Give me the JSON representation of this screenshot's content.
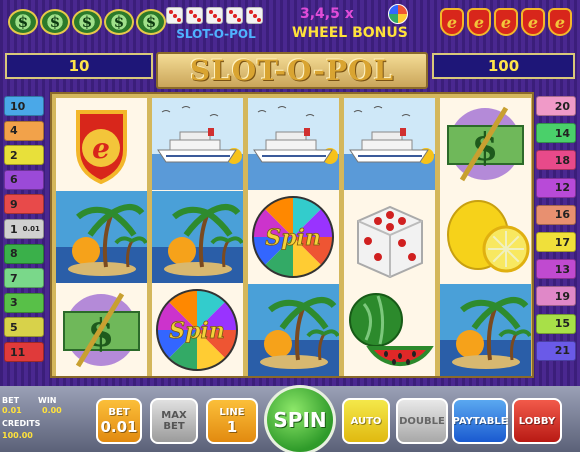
{
  "header": {
    "dollar_symbol": "$",
    "slot_o_pol_small": "SLOT-O-POL",
    "wheel_multipliers": "3,4,5 x",
    "wheel_bonus": "WHEEL BONUS",
    "e_symbol": "e"
  },
  "left_display": "10",
  "right_display": "100",
  "title": "SLOT-O-POL",
  "reels": [
    [
      "e-shield",
      "palm-island",
      "dollar-bill"
    ],
    [
      "cruise-ship",
      "palm-island",
      "spin-wheel"
    ],
    [
      "cruise-ship",
      "spin-wheel",
      "palm-island"
    ],
    [
      "cruise-ship",
      "dice",
      "watermelon"
    ],
    [
      "dollar-bill",
      "lemon",
      "palm-island"
    ]
  ],
  "symbol_text": {
    "spin": "Spin",
    "e": "e",
    "dollar": "$"
  },
  "lines_left": [
    {
      "label": "10",
      "color": "#4aa8e8"
    },
    {
      "label": "4",
      "color": "#f2a24a"
    },
    {
      "label": "2",
      "color": "#e8e03a"
    },
    {
      "label": "6",
      "color": "#9b4ad8"
    },
    {
      "label": "9",
      "color": "#e84a4a"
    },
    {
      "label": "1",
      "color": "#d0d0d0",
      "extra": "0.01"
    },
    {
      "label": "8",
      "color": "#3ab04a"
    },
    {
      "label": "7",
      "color": "#7ad88a"
    },
    {
      "label": "3",
      "color": "#58c048"
    },
    {
      "label": "5",
      "color": "#d8d24a"
    },
    {
      "label": "11",
      "color": "#e03a3a"
    }
  ],
  "lines_right": [
    {
      "label": "20",
      "color": "#f09ac8"
    },
    {
      "label": "14",
      "color": "#4ad06a"
    },
    {
      "label": "18",
      "color": "#e84a8a"
    },
    {
      "label": "12",
      "color": "#b84ad8"
    },
    {
      "label": "16",
      "color": "#e89070"
    },
    {
      "label": "17",
      "color": "#f0e03a"
    },
    {
      "label": "13",
      "color": "#c04ad0"
    },
    {
      "label": "19",
      "color": "#e088c8"
    },
    {
      "label": "15",
      "color": "#a8e048"
    },
    {
      "label": "21",
      "color": "#6a5ae8"
    }
  ],
  "footer": {
    "bet_label": "BET",
    "bet_value": "0.01",
    "win_label": "WIN",
    "win_value": "0.00",
    "credits_label": "CREDITS",
    "credits_value": "100.00"
  },
  "buttons": {
    "bet_label": "BET",
    "bet_value": "0.01",
    "max_bet_line1": "MAX",
    "max_bet_line2": "BET",
    "line_label": "LINE",
    "line_value": "1",
    "spin": "SPIN",
    "auto": "AUTO",
    "double": "DOUBLE",
    "paytable": "PAYTABLE",
    "lobby": "LOBBY"
  }
}
